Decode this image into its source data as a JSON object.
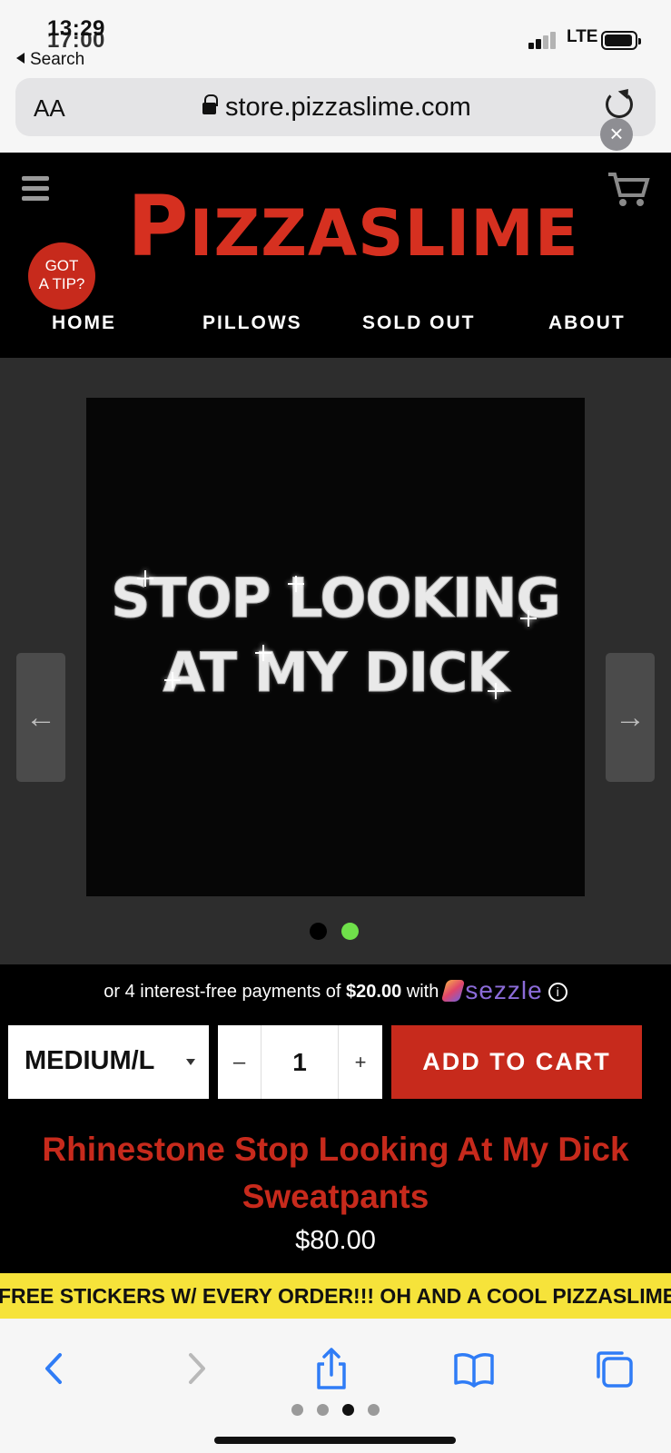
{
  "status": {
    "time_top": "13:29",
    "time_bottom": "17:00",
    "back_label": "Search",
    "network": "LTE"
  },
  "browser": {
    "text_size_label": "AA",
    "url": "store.pizzaslime.com"
  },
  "site": {
    "logo": "PIZZASLIME",
    "tip_badge": [
      "GOT",
      "A TIP?"
    ],
    "nav": [
      "HOME",
      "PILLOWS",
      "SOLD OUT",
      "ABOUT"
    ]
  },
  "gallery": {
    "image_text_line1": "STOP LOOKING",
    "image_text_line2": "AT MY DICK",
    "prev_arrow": "←",
    "next_arrow": "→",
    "slide_count": 2,
    "active_slide": 2
  },
  "purchase": {
    "installments_prefix": "or 4 interest-free payments of",
    "installment_amount": "$20.00",
    "installments_with": "with",
    "provider": "sezzle",
    "info_icon": "ⓘ",
    "size_selected": "MEDIUM/L",
    "qty_minus": "–",
    "quantity": "1",
    "qty_plus": "+",
    "add_to_cart": "ADD TO CART"
  },
  "product": {
    "title_line1": "Rhinestone Stop Looking At My Dick",
    "title_line2": "Sweatpants",
    "price": "$80.00"
  },
  "banner": {
    "text": "FREE STICKERS W/ EVERY ORDER!!! OH AND A COOL PIZZASLIME"
  },
  "colors": {
    "brand_red": "#c72a1c",
    "banner_yellow": "#f6e33a",
    "active_dot": "#6fe04a",
    "safari_blue": "#2f7cf6"
  },
  "toolbar": {
    "icons": [
      "back-icon",
      "forward-icon",
      "share-icon",
      "bookmarks-icon",
      "tabs-icon"
    ],
    "page_count": 4,
    "active_page": 3
  }
}
